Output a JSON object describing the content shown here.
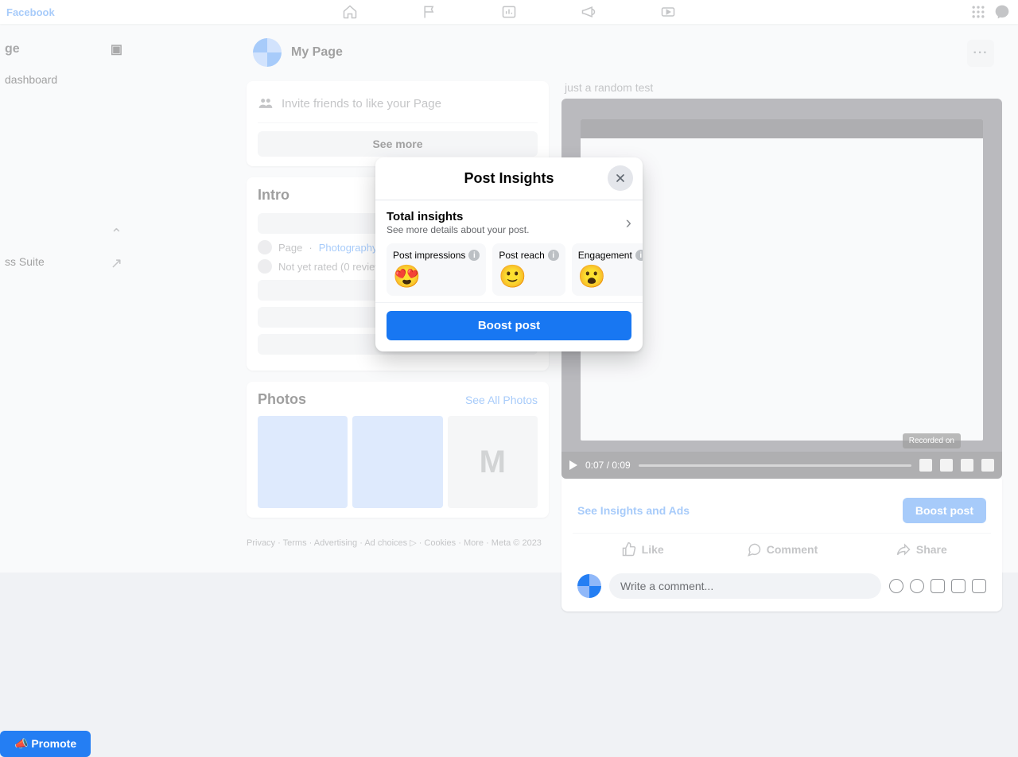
{
  "app_name": "Facebook",
  "top_nav": {
    "icons": [
      "home-icon",
      "flag-icon",
      "analytics-icon",
      "megaphone-icon",
      "video-icon",
      "grid-icon",
      "messenger-icon"
    ]
  },
  "sidebar": {
    "title": "ge",
    "items": [
      "dashboard",
      "ss Suite"
    ],
    "promote_label": "Promote"
  },
  "page": {
    "name": "My Page",
    "invite_label": "Invite friends to like your Page",
    "see_more": "See more",
    "intro_heading": "Intro",
    "meta_category": "Page · Photography an",
    "meta_rating": "Not yet rated (0 review",
    "photos_heading": "Photos",
    "see_all_photos": "See All Photos",
    "footer": "Privacy · Terms · Advertising · Ad choices ▷ · Cookies · More · Meta © 2023"
  },
  "post": {
    "caption": "just a random test",
    "time": "0:07 / 0:09",
    "recorded_badge": "Recorded on",
    "insights_link": "See Insights and Ads",
    "boost_mini": "Boost post",
    "actions": {
      "like": "Like",
      "comment": "Comment",
      "share": "Share"
    },
    "comment_placeholder": "Write a comment..."
  },
  "modal": {
    "title": "Post Insights",
    "total_heading": "Total insights",
    "total_sub": "See more details about your post.",
    "metrics": [
      {
        "label": "Post impressions",
        "emoji": "😍"
      },
      {
        "label": "Post reach",
        "emoji": "🙂"
      },
      {
        "label": "Engagement",
        "emoji": "😮"
      }
    ],
    "boost_label": "Boost post"
  }
}
